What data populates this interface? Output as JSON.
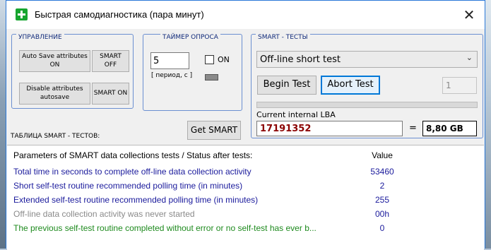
{
  "window": {
    "title": "Быстрая самодиагностика (пара минут)",
    "close_glyph": "✕"
  },
  "control_group": {
    "label": "УПРАВЛЕНИЕ",
    "auto_save_on": "Auto Save attributes ON",
    "smart_off": "SMART OFF",
    "disable_autosave": "Disable attributes autosave",
    "smart_on": "SMART ON"
  },
  "timer_group": {
    "label": "ТАЙМЕР ОПРОСА",
    "period_value": "5",
    "on_label": "ON",
    "period_label": "[ период, с ]"
  },
  "smart_tests_group": {
    "label": "SMART - ТЕСТЫ",
    "selected_test": "Off-line short test",
    "begin_test": "Begin Test",
    "abort_test": "Abort Test",
    "counter_value": "1",
    "progress": 0,
    "lba_label": "Current internal LBA",
    "lba_value": "17191352",
    "equals": "=",
    "size_value": "8,80 GB"
  },
  "tests_table_label": "ТАБЛИЦА  SMART - ТЕСТОВ:",
  "get_smart": "Get SMART",
  "table": {
    "header_param": "Parameters of SMART data collections tests / Status after tests:",
    "header_value": "Value",
    "rows": [
      {
        "param": "Total time in seconds to complete off-line data collection activity",
        "value": "53460",
        "color": "#1a1a9c"
      },
      {
        "param": "Short self-test routine recommended polling time (in minutes)",
        "value": "2",
        "color": "#1a1a9c"
      },
      {
        "param": "Extended self-test routine recommended polling time (in minutes)",
        "value": "255",
        "color": "#1a1a9c"
      },
      {
        "param": "Off-line data collection activity was never started",
        "value": "00h",
        "color": "#8a8a8a"
      },
      {
        "param": "The previous self-test routine completed without error or no self-test has ever b...",
        "value": "0",
        "color": "#1e8a1e"
      }
    ]
  },
  "colors": {
    "accent": "#2b79d8",
    "lba_text": "#8b0000",
    "green_icon": "#16a52f"
  }
}
